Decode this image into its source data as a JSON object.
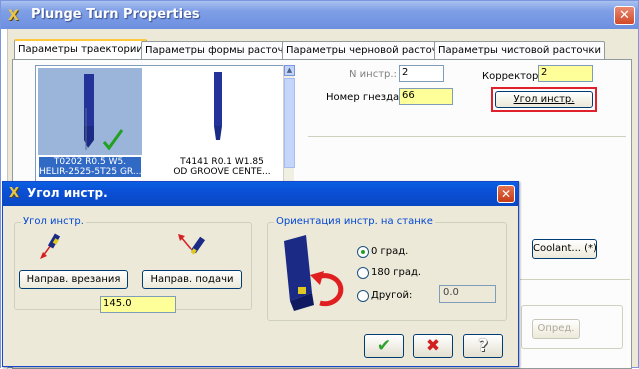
{
  "window": {
    "title": "Plunge Turn Properties",
    "close_glyph": "✕"
  },
  "tabs": [
    {
      "label": "Параметры траектории",
      "active": true
    },
    {
      "label": "Параметры формы расточки",
      "active": false
    },
    {
      "label": "Параметры черновой расточки",
      "active": false
    },
    {
      "label": "Параметры чистовой расточки",
      "active": false
    }
  ],
  "tools": [
    {
      "caption_line1": "T0202 R0.5 W5.",
      "caption_line2": "HELIR-2525-5T25 GR...",
      "selected": true
    },
    {
      "caption_line1": "T4141 R0.1 W1.85",
      "caption_line2": "OD GROOVE CENTE...",
      "selected": false
    }
  ],
  "tool_params": {
    "n_instr_label": "N инстр.:",
    "n_instr_value": "2",
    "korrektor_label": "Корректор:",
    "korrektor_value": "2",
    "gnezdo_label": "Номер гнезда:",
    "gnezdo_value": "66",
    "ugol_button": "Угол инстр."
  },
  "right_buttons": {
    "coolant": "Coolant... (*)",
    "opred": "Опред."
  },
  "dialog": {
    "title": "Угол инстр.",
    "close_glyph": "✕",
    "angle_group_label": "Угол инстр.",
    "naprav_vrezaniya": "Направ. врезания",
    "naprav_podachi": "Направ. подачи",
    "angle_value": "145.0",
    "orient_group_label": "Ориентация инстр. на станке",
    "radio_options": [
      {
        "label": "0 град.",
        "checked": true
      },
      {
        "label": "180 град.",
        "checked": false
      },
      {
        "label": "Другой:",
        "checked": false
      }
    ],
    "other_value": "0.0",
    "ok_glyph": "✔",
    "cancel_glyph": "✖",
    "help_glyph": "?"
  },
  "colors": {
    "xp_blue_title": "#0b4fd6",
    "field_yellow": "#ffff99",
    "highlight_red": "#e0202a",
    "selection_blue": "#316ac5"
  }
}
